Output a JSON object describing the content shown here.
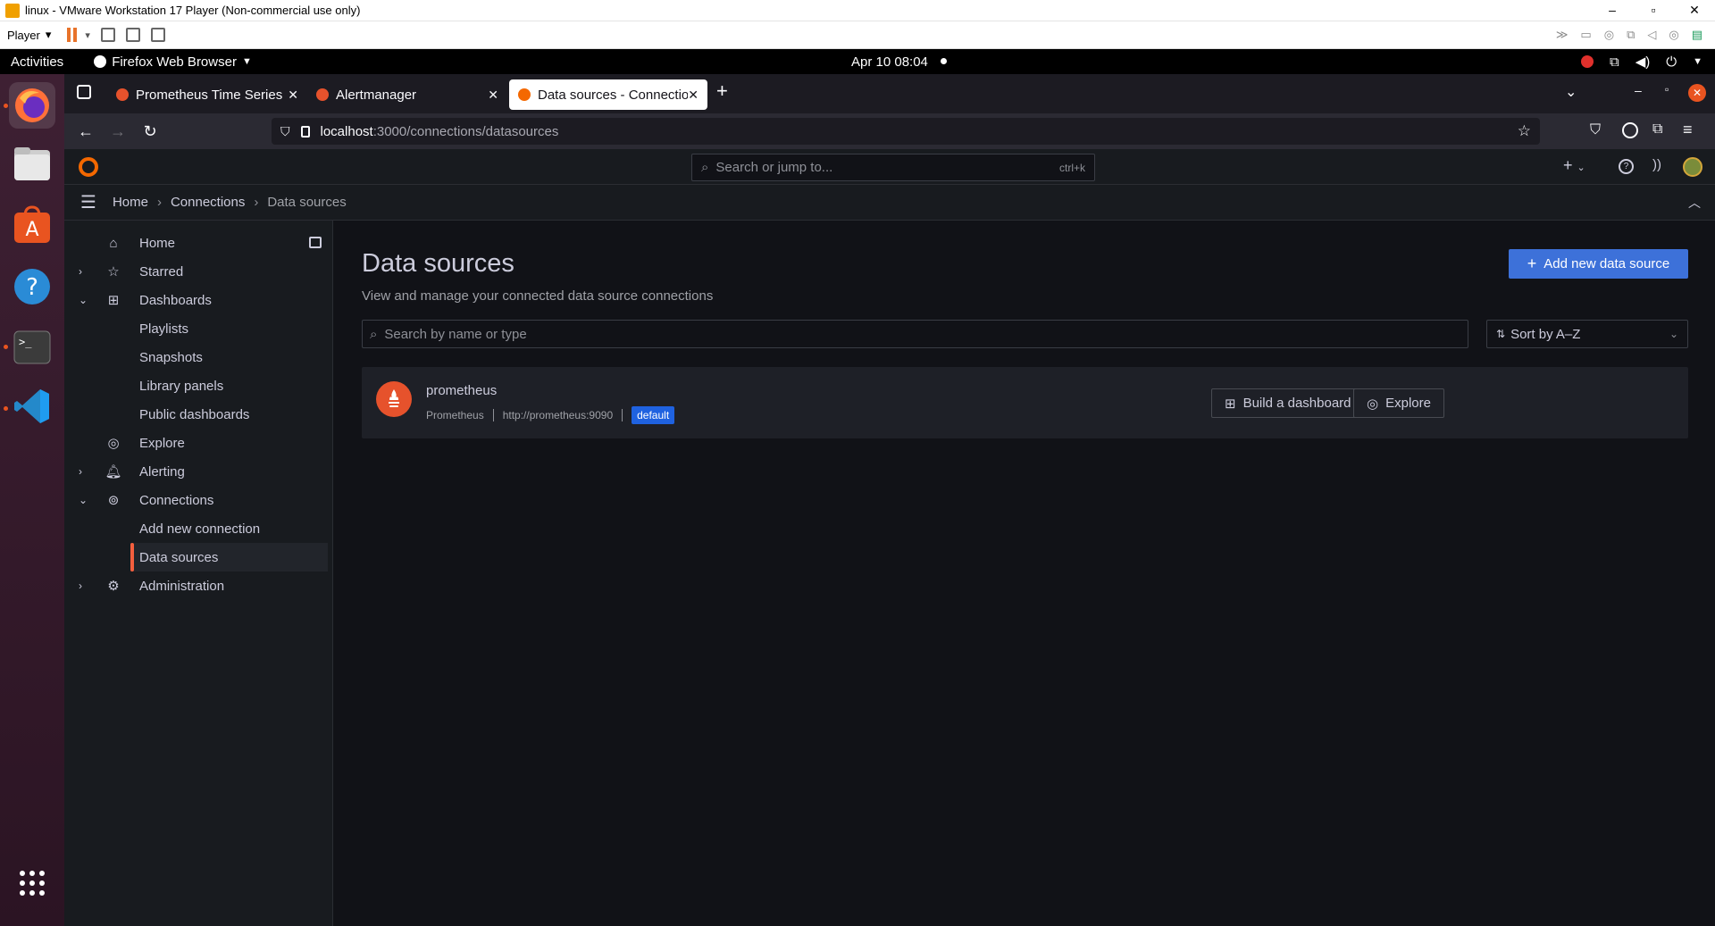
{
  "vmware": {
    "title": "linux - VMware Workstation 17 Player (Non-commercial use only)",
    "player_label": "Player",
    "win_controls": [
      "–",
      "▫",
      "✕"
    ]
  },
  "gnome": {
    "activities": "Activities",
    "app_name": "Firefox Web Browser",
    "clock": "Apr 10  08:04"
  },
  "dock": {
    "items": [
      "firefox-icon",
      "files-icon",
      "app-center-icon",
      "help-icon",
      "terminal-icon",
      "vscode-icon",
      "app-grid-icon"
    ]
  },
  "firefox": {
    "tabs": [
      {
        "label": "Prometheus Time Series",
        "active": false
      },
      {
        "label": "Alertmanager",
        "active": false
      },
      {
        "label": "Data sources - Connectio",
        "active": true
      }
    ],
    "url_host": "localhost",
    "url_path": ":3000/connections/datasources"
  },
  "grafana": {
    "search_placeholder": "Search or jump to...",
    "search_shortcut": "ctrl+k",
    "breadcrumb": [
      "Home",
      "Connections",
      "Data sources"
    ],
    "nav": [
      {
        "label": "Home",
        "chev": "",
        "icon": "home-icon"
      },
      {
        "label": "Starred",
        "chev": "›",
        "icon": "star-icon"
      },
      {
        "label": "Dashboards",
        "chev": "⌄",
        "icon": "grid-icon"
      },
      {
        "label": "Playlists",
        "chev": "",
        "icon": ""
      },
      {
        "label": "Snapshots",
        "chev": "",
        "icon": ""
      },
      {
        "label": "Library panels",
        "chev": "",
        "icon": ""
      },
      {
        "label": "Public dashboards",
        "chev": "",
        "icon": ""
      },
      {
        "label": "Explore",
        "chev": "",
        "icon": "compass-icon"
      },
      {
        "label": "Alerting",
        "chev": "›",
        "icon": "bell-icon"
      },
      {
        "label": "Connections",
        "chev": "⌄",
        "icon": "connections-icon"
      },
      {
        "label": "Add new connection",
        "chev": "",
        "icon": ""
      },
      {
        "label": "Data sources",
        "chev": "",
        "icon": "",
        "active": true
      },
      {
        "label": "Administration",
        "chev": "›",
        "icon": "cog-icon"
      }
    ],
    "page_title": "Data sources",
    "page_subtitle": "View and manage your connected data source connections",
    "add_button": "Add new data source",
    "list_search_placeholder": "Search by name or type",
    "sort_label": "Sort by A–Z",
    "datasource": {
      "name": "prometheus",
      "type": "Prometheus",
      "url": "http://prometheus:9090",
      "badge": "default",
      "build_button": "Build a dashboard",
      "explore_button": "Explore"
    }
  },
  "colors": {
    "grafana_bg": "#111217",
    "panel_bg": "#181b1f",
    "primary": "#3d71d9",
    "accent": "#f55f3e",
    "prometheus": "#e6522c"
  }
}
